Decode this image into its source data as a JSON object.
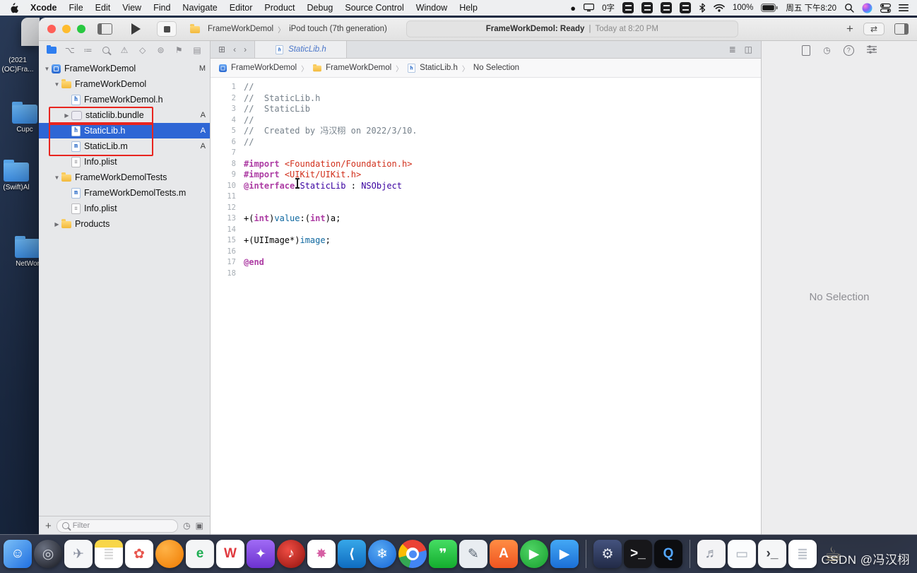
{
  "menu_bar": {
    "app_name": "Xcode",
    "items": [
      "File",
      "Edit",
      "View",
      "Find",
      "Navigate",
      "Editor",
      "Product",
      "Debug",
      "Source Control",
      "Window",
      "Help"
    ],
    "status_text": "0字",
    "battery_label": "100%",
    "clock": "周五 下午8:20"
  },
  "toolbar": {
    "scheme_project": "FrameWorkDemol",
    "scheme_device": "iPod touch (7th generation)",
    "status_title": "FrameWorkDemol: Ready",
    "status_sep": "|",
    "status_time": "Today at 8:20 PM"
  },
  "navigator": {
    "filter_placeholder": "Filter",
    "tree": [
      {
        "label": "FrameWorkDemol",
        "icon": "project",
        "indent": 0,
        "disclosure": "open",
        "badge": "M"
      },
      {
        "label": "FrameWorkDemol",
        "icon": "folder",
        "indent": 1,
        "disclosure": "open"
      },
      {
        "label": "FrameWorkDemol.h",
        "icon": "h",
        "indent": 2
      },
      {
        "label": "staticlib.bundle",
        "icon": "bundle",
        "indent": 2,
        "disclosure": "closed",
        "badge": "A",
        "outline_group": 1
      },
      {
        "label": "StaticLib.h",
        "icon": "h",
        "indent": 2,
        "badge": "A",
        "selected": true,
        "outline_group": 2
      },
      {
        "label": "StaticLib.m",
        "icon": "m",
        "indent": 2,
        "badge": "A",
        "outline_group": 2
      },
      {
        "label": "Info.plist",
        "icon": "plist",
        "indent": 2
      },
      {
        "label": "FrameWorkDemolTests",
        "icon": "folder",
        "indent": 1,
        "disclosure": "open"
      },
      {
        "label": "FrameWorkDemolTests.m",
        "icon": "m",
        "indent": 2
      },
      {
        "label": "Info.plist",
        "icon": "plist",
        "indent": 2
      },
      {
        "label": "Products",
        "icon": "folder",
        "indent": 1,
        "disclosure": "closed"
      }
    ]
  },
  "editor": {
    "tab_label": "StaticLib.h",
    "breadcrumb": [
      {
        "icon": "project",
        "label": "FrameWorkDemol"
      },
      {
        "icon": "folder",
        "label": "FrameWorkDemol"
      },
      {
        "icon": "h",
        "label": "StaticLib.h"
      },
      {
        "icon": "",
        "label": "No Selection"
      }
    ],
    "code_lines": [
      {
        "n": 1,
        "t": [
          [
            "c",
            "//"
          ]
        ]
      },
      {
        "n": 2,
        "t": [
          [
            "c",
            "//  StaticLib.h"
          ]
        ]
      },
      {
        "n": 3,
        "t": [
          [
            "c",
            "//  StaticLib"
          ]
        ]
      },
      {
        "n": 4,
        "t": [
          [
            "c",
            "//"
          ]
        ]
      },
      {
        "n": 5,
        "t": [
          [
            "c",
            "//  Created by 冯汉栩 on 2022/3/10."
          ]
        ]
      },
      {
        "n": 6,
        "t": [
          [
            "c",
            "//"
          ]
        ]
      },
      {
        "n": 7,
        "t": []
      },
      {
        "n": 8,
        "t": [
          [
            "d",
            "#import"
          ],
          [
            "p",
            " "
          ],
          [
            "s",
            "<Foundation/Foundation.h>"
          ]
        ]
      },
      {
        "n": 9,
        "t": [
          [
            "d",
            "#import"
          ],
          [
            "p",
            " "
          ],
          [
            "s",
            "<UIKit/UIKit.h>"
          ]
        ]
      },
      {
        "n": 10,
        "t": [
          [
            "k",
            "@interface"
          ],
          [
            "p",
            " "
          ],
          [
            "ty",
            "StaticLib"
          ],
          [
            "p",
            " : "
          ],
          [
            "ty",
            "NSObject"
          ]
        ]
      },
      {
        "n": 11,
        "t": []
      },
      {
        "n": 12,
        "t": []
      },
      {
        "n": 13,
        "t": [
          [
            "p",
            "+("
          ],
          [
            "k",
            "int"
          ],
          [
            "p",
            ")"
          ],
          [
            "f",
            "value"
          ],
          [
            "p",
            ":("
          ],
          [
            "k",
            "int"
          ],
          [
            "p",
            ")a;"
          ]
        ]
      },
      {
        "n": 14,
        "t": []
      },
      {
        "n": 15,
        "t": [
          [
            "p",
            "+(UIImage*)"
          ],
          [
            "f",
            "image"
          ],
          [
            "p",
            ";"
          ]
        ]
      },
      {
        "n": 16,
        "t": []
      },
      {
        "n": 17,
        "t": [
          [
            "k",
            "@end"
          ]
        ]
      },
      {
        "n": 18,
        "t": []
      }
    ]
  },
  "inspector": {
    "empty_text": "No Selection"
  },
  "desktop": {
    "items": [
      {
        "label": "(2021 (OC)Fra...",
        "folder": false
      },
      {
        "label": "Cupc",
        "folder": true
      },
      {
        "label": "(Swift)Al",
        "folder": true
      },
      {
        "label": "NetWor",
        "folder": true
      }
    ]
  },
  "dock": {
    "apps": [
      {
        "name": "finder",
        "glyph": "☺",
        "bg": "linear-gradient(135deg,#7cc0f8,#1f6fe0)",
        "fg": "#ffffff"
      },
      {
        "name": "dark-sphere",
        "glyph": "◎",
        "bg": "radial-gradient(circle at 35% 30%,#6a7080,#15171e)",
        "fg": "#cfd3da",
        "round": true
      },
      {
        "name": "launchpad",
        "glyph": "✈",
        "bg": "#f5f6f8",
        "fg": "#8a90a0"
      },
      {
        "name": "notes",
        "glyph": "≣",
        "bg": "linear-gradient(#f8d648 0%,#f8d648 28%,#ffffff 28%)",
        "fg": "#d8d8d8"
      },
      {
        "name": "photos",
        "glyph": "✿",
        "bg": "#ffffff",
        "fg": "#e8554d"
      },
      {
        "name": "orange-ball",
        "glyph": "",
        "bg": "radial-gradient(circle at 35% 30%,#ffb347,#ef7a00)",
        "fg": "#ffffff",
        "round": true
      },
      {
        "name": "evernote",
        "glyph": "e",
        "bg": "#f4f5f6",
        "fg": "#1fae53"
      },
      {
        "name": "word",
        "glyph": "W",
        "bg": "#ffffff",
        "fg": "#e03a3f"
      },
      {
        "name": "purple-app",
        "glyph": "✦",
        "bg": "linear-gradient(#a06bf5,#6c32cf)",
        "fg": "#ffffff"
      },
      {
        "name": "music",
        "glyph": "♪",
        "bg": "radial-gradient(circle at 40% 35%,#ef4d44,#90110c)",
        "fg": "#ffffff",
        "round": true
      },
      {
        "name": "palette",
        "glyph": "✸",
        "bg": "#ffffff",
        "fg": "#d65fa4"
      },
      {
        "name": "vscode",
        "glyph": "⟨",
        "bg": "linear-gradient(#37a7e9,#0f6cc0)",
        "fg": "#ffffff"
      },
      {
        "name": "blue-flake",
        "glyph": "❄",
        "bg": "radial-gradient(circle at 40% 35%,#57a9f2,#1565d8)",
        "fg": "#ffffff",
        "round": true
      },
      {
        "name": "chrome",
        "glyph": "",
        "bg": "#ffffff",
        "fg": "#ffffff",
        "chrome": true
      },
      {
        "name": "wechat",
        "glyph": "❞",
        "bg": "linear-gradient(#45dd63,#14ad2e)",
        "fg": "#ffffff"
      },
      {
        "name": "compose",
        "glyph": "✎",
        "bg": "#e9edf1",
        "fg": "#5c6774"
      },
      {
        "name": "orange-a",
        "glyph": "A",
        "bg": "linear-gradient(#ff8d44,#ef5420)",
        "fg": "#ffffff"
      },
      {
        "name": "green-play",
        "glyph": "▶",
        "bg": "radial-gradient(circle at 40% 35%,#4fd364,#17a02e)",
        "fg": "#ffffff",
        "round": true
      },
      {
        "name": "blue-play",
        "glyph": "▶",
        "bg": "linear-gradient(#44a8f5,#1b6fd6)",
        "fg": "#ffffff"
      },
      {
        "sep": true
      },
      {
        "name": "navy-tool",
        "glyph": "⚙",
        "bg": "linear-gradient(#44537e,#222b47)",
        "fg": "#e8eaf2"
      },
      {
        "name": "terminal",
        "glyph": ">_",
        "bg": "#17171a",
        "fg": "#f2f2f2"
      },
      {
        "name": "q-search",
        "glyph": "Q",
        "bg": "#0c0d10",
        "fg": "#53a7ff"
      },
      {
        "sep": true
      },
      {
        "name": "score-doc",
        "glyph": "♬",
        "bg": "#f3f3f5",
        "fg": "#8d93a0"
      },
      {
        "name": "mini-window",
        "glyph": "▭",
        "bg": "#fbfcfd",
        "fg": "#aab1bb"
      },
      {
        "name": "mini-terminal",
        "glyph": "›_",
        "bg": "#f5f6f7",
        "fg": "#3c3f45"
      },
      {
        "name": "doc",
        "glyph": "≣",
        "bg": "#ffffff",
        "fg": "#c0c5cd"
      },
      {
        "name": "mug",
        "glyph": "☕",
        "bg": "none",
        "fg": "#d9c9a0",
        "flat": true
      }
    ]
  },
  "watermark": "CSDN @冯汉栩"
}
